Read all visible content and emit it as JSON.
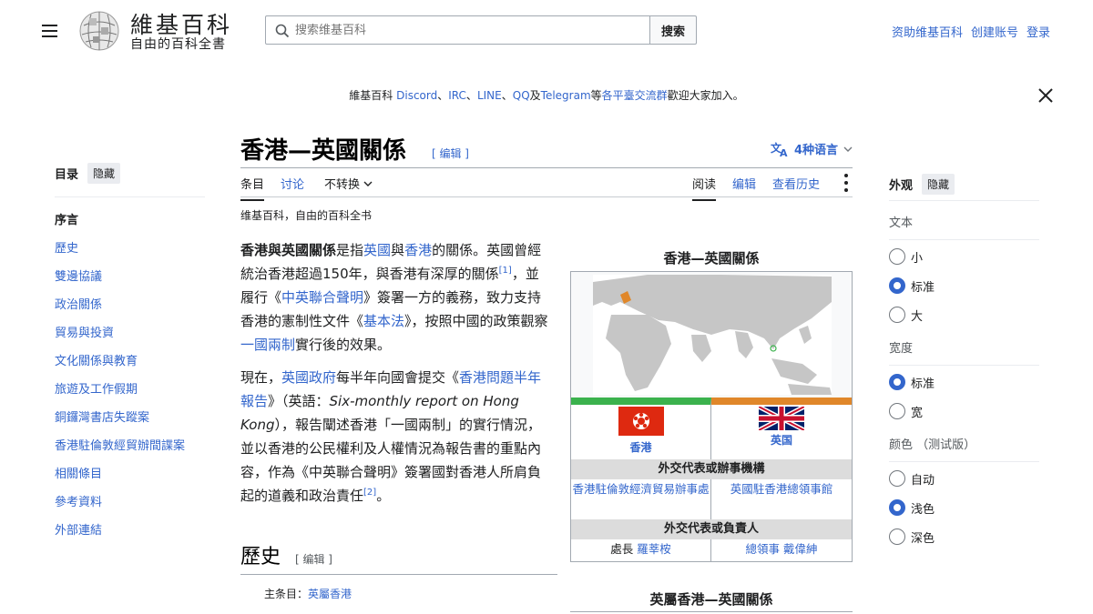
{
  "header": {
    "logo_title": "維基百科",
    "logo_subtitle": "自由的百科全書",
    "search_placeholder": "搜索维基百科",
    "search_button": "搜索",
    "links": [
      "资助维基百科",
      "创建账号",
      "登录"
    ]
  },
  "banner": {
    "prefix": "維基百科 ",
    "discord": "Discord",
    "sep1": "、",
    "irc": "IRC",
    "sep2": "、",
    "line": "LINE",
    "sep3": "、",
    "qq": "QQ",
    "and": "及",
    "telegram": "Telegram",
    "deng": "等",
    "group": "各平臺交流群",
    "suffix": "歡迎大家加入。"
  },
  "toc": {
    "title": "目录",
    "hide": "隐藏",
    "items": [
      "序言",
      "歷史",
      "雙邊協議",
      "政治關係",
      "貿易與投資",
      "文化關係與教育",
      "旅遊及工作假期",
      "銅鑼灣書店失蹤案",
      "香港駐倫敦經貿辦間諜案",
      "相關條目",
      "參考資料",
      "外部連結"
    ]
  },
  "article": {
    "title": "香港—英國關係",
    "edit": "[ 编辑 ]",
    "languages": "4种语言",
    "tabs": {
      "article": "条目",
      "talk": "讨论",
      "variant": "不转换",
      "read": "阅读",
      "edit": "编辑",
      "history": "查看历史"
    },
    "tagline": "维基百科，自由的百科全书",
    "p1": {
      "bold": "香港與英國關係",
      "t1": "是指",
      "l1": "英國",
      "t2": "與",
      "l2": "香港",
      "t3": "的關係。英國曾經統治香港超過150年，與香港有深厚的關係",
      "ref1": "[1]",
      "t4": "，並履行《",
      "l3": "中英聯合聲明",
      "t5": "》簽署一方的義務，致力支持香港的憲制性文件《",
      "l4": "基本法",
      "t6": "》，按照中國的政策觀察",
      "l5": "一國兩制",
      "t7": "實行後的效果。"
    },
    "p2": {
      "t1": "現在，",
      "l1": "英國政府",
      "t2": "每半年向國會提交《",
      "l2": "香港問題半年報告",
      "t3": "》（英語：",
      "it": "Six-monthly report on Hong Kong",
      "t4": "），報告闡述香港「一國兩制」的實行情況，並以香港的公民權利及人權情況為報告書的重點內容，作為《中英聯合聲明》簽署國對香港人所肩負起的道義和政治責任",
      "ref2": "[2]",
      "t5": "。"
    },
    "h2": "歷史",
    "h2_edit": "[ 编辑 ]",
    "main_label": "主条目：",
    "main_link": "英屬香港"
  },
  "infobox": {
    "caption": "香港—英國關係",
    "hk": "香港",
    "uk": "英国",
    "head1": "外交代表或辦事機構",
    "office_hk": "香港駐倫敦經濟貿易辦事處",
    "office_uk": "英國駐香港總領事館",
    "head2": "外交代表或負責人",
    "rep_hk_title": "處長 ",
    "rep_hk_name": "羅莘桉",
    "rep_uk_title": "總領事 ",
    "rep_uk_name": "戴偉紳",
    "next_caption": "英屬香港—英國關係"
  },
  "appearance": {
    "title": "外观",
    "hide": "隐藏",
    "text_label": "文本",
    "text_options": [
      "小",
      "标准",
      "大"
    ],
    "text_selected": "标准",
    "width_label": "宽度",
    "width_options": [
      "标准",
      "宽"
    ],
    "width_selected": "标准",
    "color_label": "颜色 （测试版）",
    "color_options": [
      "自动",
      "浅色",
      "深色"
    ],
    "color_selected": "浅色"
  },
  "colors": {
    "link": "#3366cc",
    "hk_band": "#3bb24d",
    "uk_band": "#e0872a",
    "hk_flag": "#de2910"
  }
}
